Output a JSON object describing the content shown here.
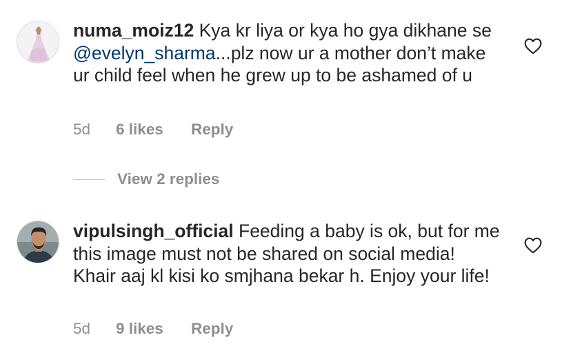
{
  "comments": [
    {
      "username": "numa_moiz12",
      "text_before": " Kya kr liya or kya ho gya dikhane se ",
      "mention": "@evelyn_sharma",
      "text_after": "...plz now ur a mother don’t make ur child feel when he grew up to be ashamed of u",
      "time": "5d",
      "likes": "6 likes",
      "reply": "Reply",
      "view_replies": "View 2 replies"
    },
    {
      "username": "vipulsingh_official",
      "text": " Feeding a baby is ok, but for me this image must not be shared on social media! Khair aaj kl kisi ko smjhana bekar h. Enjoy your life!",
      "time": "5d",
      "likes": "9 likes",
      "reply": "Reply"
    }
  ],
  "icons": {
    "like": "heart-outline-icon"
  }
}
